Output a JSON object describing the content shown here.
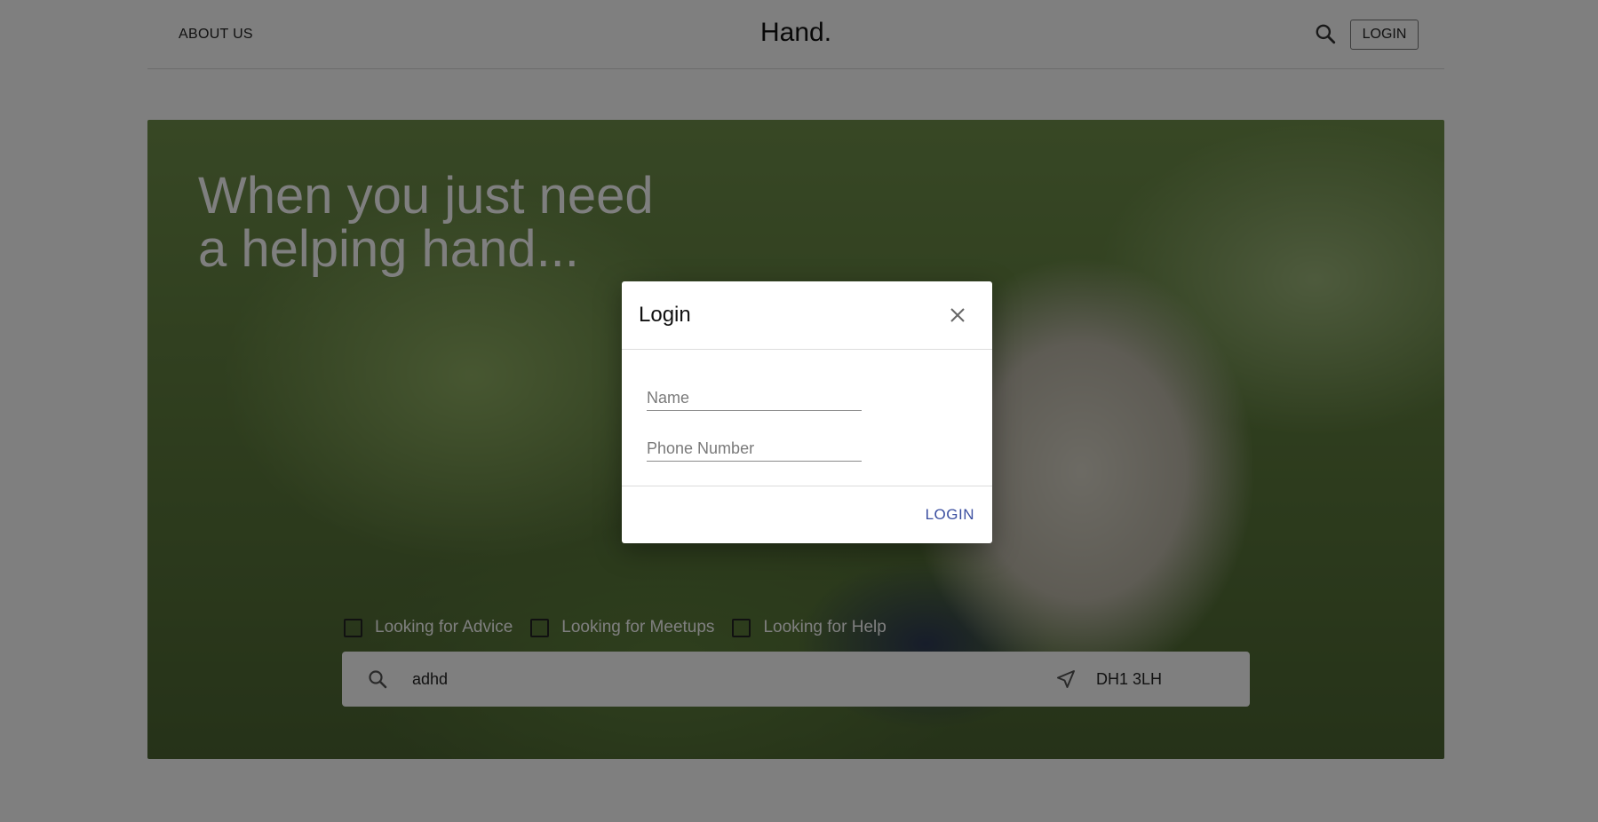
{
  "header": {
    "about_label": "ABOUT US",
    "brand": "Hand.",
    "login_label": "LOGIN",
    "search_icon": "search-icon"
  },
  "hero": {
    "title_line1": "When you just need",
    "title_line2": "a helping hand...",
    "filters": [
      {
        "label": "Looking for Advice",
        "checked": false
      },
      {
        "label": "Looking for Meetups",
        "checked": false
      },
      {
        "label": "Looking for Help",
        "checked": false
      }
    ],
    "search": {
      "query": "adhd",
      "location": "DH1 3LH",
      "search_icon": "search-icon",
      "location_icon": "navigation-arrow-icon"
    }
  },
  "modal": {
    "title": "Login",
    "name_placeholder": "Name",
    "phone_placeholder": "Phone Number",
    "login_label": "LOGIN",
    "close_icon": "close-icon"
  },
  "colors": {
    "overlay": "rgba(0,0,0,0.5)",
    "accent": "#3b4fa0"
  }
}
